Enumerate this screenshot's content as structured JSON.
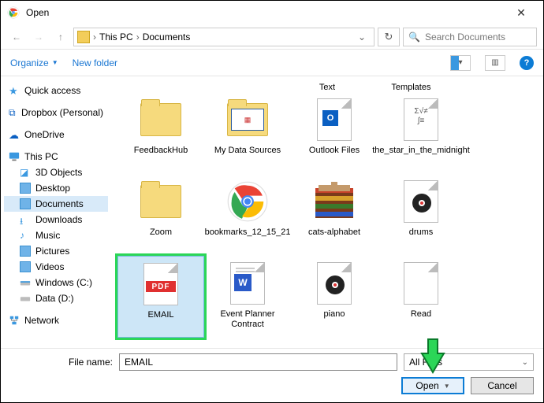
{
  "title": "Open",
  "breadcrumb": {
    "root": "This PC",
    "folder": "Documents"
  },
  "search": {
    "placeholder": "Search Documents"
  },
  "toolbar": {
    "organize": "Organize",
    "newfolder": "New folder"
  },
  "sidebar": {
    "quick": "Quick access",
    "dropbox": "Dropbox (Personal)",
    "onedrive": "OneDrive",
    "thispc": "This PC",
    "children": {
      "obj3d": "3D Objects",
      "desktop": "Desktop",
      "documents": "Documents",
      "downloads": "Downloads",
      "music": "Music",
      "pictures": "Pictures",
      "videos": "Videos",
      "cdrive": "Windows (C:)",
      "ddrive": "Data (D:)"
    },
    "network": "Network"
  },
  "top_partial": {
    "text": "Text",
    "templates": "Templates"
  },
  "files": {
    "feedbackhub": "FeedbackHub",
    "mydatasources": "My Data Sources",
    "outlookfiles": "Outlook Files",
    "star": "the_star_in_the_midnight",
    "zoom": "Zoom",
    "bookmarks": "bookmarks_12_15_21",
    "cats": "cats-alphabet",
    "drums": "drums",
    "email": "EMAIL",
    "eventplanner": "Event Planner Contract",
    "piano": "piano",
    "read": "Read"
  },
  "filename_label": "File name:",
  "filename_value": "EMAIL",
  "filetype": "All Files",
  "buttons": {
    "open": "Open",
    "cancel": "Cancel"
  }
}
